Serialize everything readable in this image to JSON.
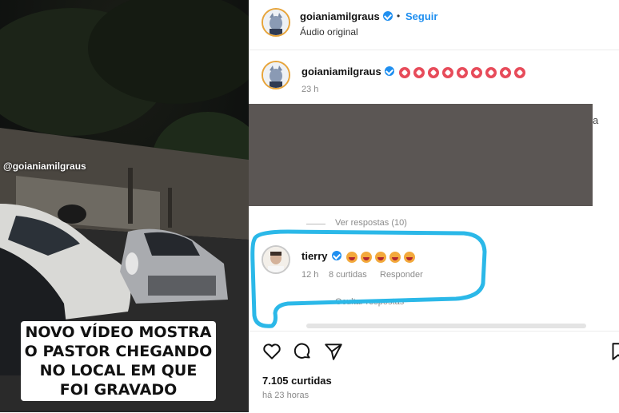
{
  "video": {
    "watermark": "@goianiamilgraus",
    "caption": "NOVO VÍDEO MOSTRA O PASTOR CHEGANDO NO LOCAL EM QUE FOI GRAVADO"
  },
  "header": {
    "username": "goianiamilgraus",
    "separator": "•",
    "follow_label": "Seguir",
    "subtitle": "Áudio original"
  },
  "post_caption": {
    "username": "goianiamilgraus",
    "emoji_count": 9,
    "time": "23 h"
  },
  "redacted": {
    "color": "#5b5654",
    "partial_text": "a"
  },
  "replies_link": "Ver respostas (10)",
  "comment": {
    "username": "tierry",
    "emoji_count": 5,
    "time": "12 h",
    "likes": "8 curtidas",
    "reply_label": "Responder"
  },
  "hide_replies": "Ocultar respostas",
  "actions": {
    "likes": "7.105 curtidas",
    "posted": "há 23 horas"
  },
  "colors": {
    "highlight": "#2bb8e8",
    "link": "#1f8ff0"
  },
  "icons": [
    "heart-icon",
    "comment-icon",
    "share-icon",
    "bookmark-icon",
    "verified-icon"
  ]
}
